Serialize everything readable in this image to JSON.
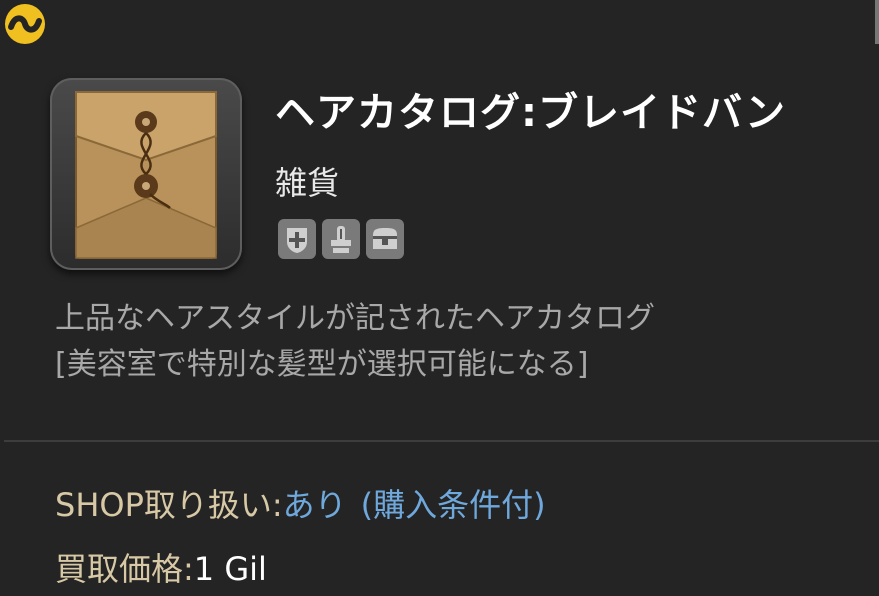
{
  "item": {
    "name": "ヘアカタログ:ブレイドバン",
    "category": "雑貨",
    "icon": "envelope-icon",
    "flags": [
      "unique-icon",
      "untradable-icon",
      "storage-icon"
    ]
  },
  "description": {
    "line1": "上品なヘアスタイルが記されたヘアカタログ",
    "line2": "[美容室で特別な髪型が選択可能になる]"
  },
  "shop": {
    "label": "SHOP取り扱い:",
    "value": "あり",
    "condition": "(購入条件付)"
  },
  "sell": {
    "label": "買取価格:",
    "value": "1 Gil"
  },
  "colors": {
    "background": "#242424",
    "label": "#d8c9a6",
    "link": "#6fa8dc",
    "description": "#a8a8a8"
  }
}
